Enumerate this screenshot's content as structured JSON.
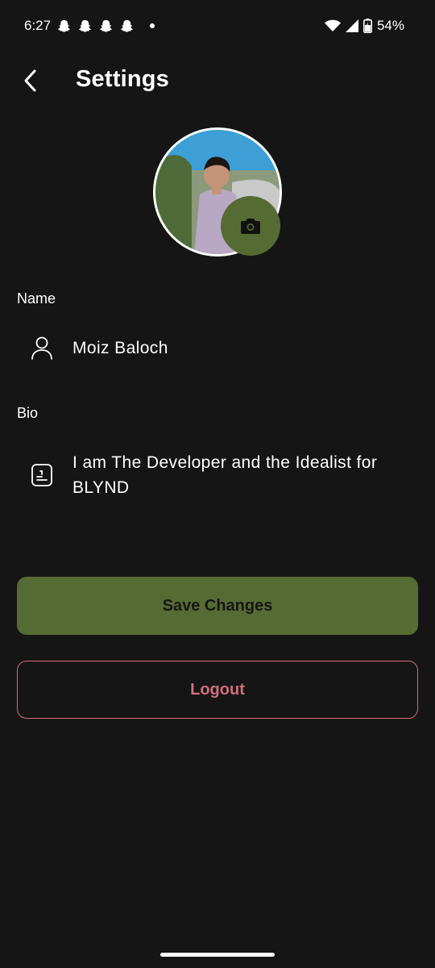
{
  "status_bar": {
    "time": "6:27",
    "battery": "54%",
    "notification_icons": [
      "snapchat-icon",
      "snapchat-icon",
      "snapchat-icon",
      "snapchat-icon"
    ]
  },
  "header": {
    "title": "Settings",
    "back_icon": "chevron-left-icon"
  },
  "profile": {
    "avatar": "profile-photo",
    "camera_icon": "camera-icon"
  },
  "form": {
    "name_label": "Name",
    "name_value": "Moiz Baloch",
    "name_icon": "person-icon",
    "bio_label": "Bio",
    "bio_value": "I am The Developer and the Idealist for BLYND",
    "bio_icon": "note-icon"
  },
  "actions": {
    "save_label": "Save Changes",
    "logout_label": "Logout"
  },
  "colors": {
    "background": "#151515",
    "accent": "#566b33",
    "logout": "#d16d80",
    "text": "#ffffff"
  }
}
